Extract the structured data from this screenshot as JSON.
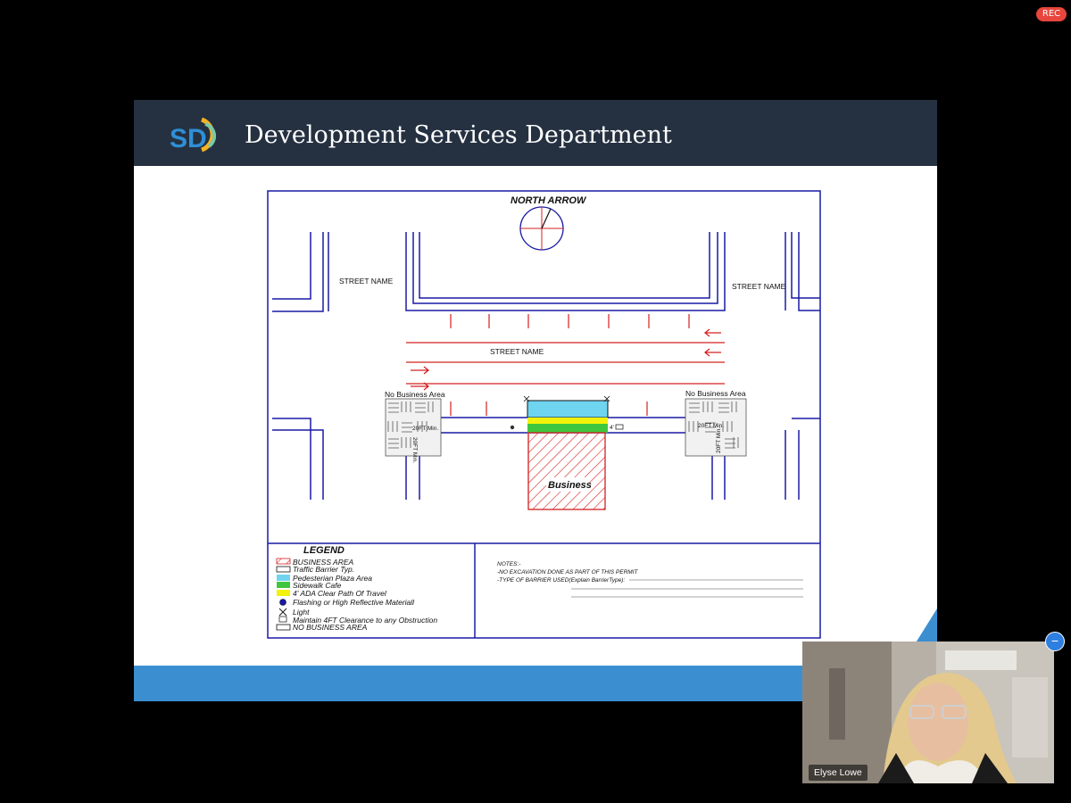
{
  "recording": {
    "label": "REC"
  },
  "slide": {
    "logo": {
      "letters": "SD"
    },
    "title": "Development Services Department",
    "drawing": {
      "north_arrow": "NORTH ARROW",
      "street_names": {
        "top_left": "STREET NAME",
        "top_right": "STREET NAME",
        "center": "STREET NAME"
      },
      "no_business_left": "No Business Area",
      "no_business_right": "No Business Area",
      "dim_left_h": "20FT Min.",
      "dim_left_v": "20FT Min.",
      "dim_right_h": "20FT Min.",
      "dim_right_v": "20FT Min.",
      "dim_small": "4'",
      "business": "Business",
      "legend": {
        "title": "LEGEND",
        "items": [
          "BUSINESS AREA",
          "Traffic Barrier Typ.",
          "Pedesterian Plaza Area",
          "Sidewalk Cafe",
          "4' ADA Clear Path Of Travel",
          "Flashing or High Reflective Materiall",
          "Light",
          "Maintain 4FT Clearance to any Obstruction",
          "NO BUSINESS AREA"
        ]
      },
      "notes": {
        "title": "NOTES:-",
        "lines": [
          "-NO EXCAVATION DONE AS PART OF THIS PERMIT",
          "-TYPE OF BARRIER USED(Explain BarrierType):"
        ]
      }
    }
  },
  "participant": {
    "name": "Elyse Lowe"
  },
  "colors": {
    "header": "#253141",
    "footer": "#3b8fd1",
    "line": "#1a1aa6",
    "red": "#d42020",
    "cyan": "#6fd4f0",
    "green": "#3fc63f",
    "yellow": "#f2f20a"
  }
}
